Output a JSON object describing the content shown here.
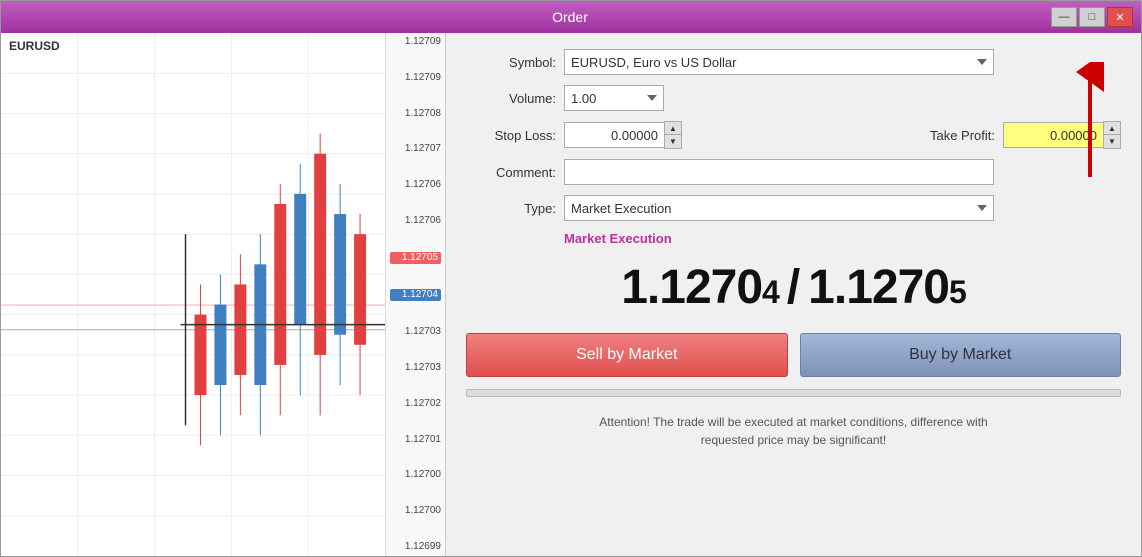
{
  "window": {
    "title": "Order",
    "controls": {
      "minimize": "—",
      "maximize": "□",
      "close": "✕"
    }
  },
  "chart": {
    "symbol_label": "EURUSD",
    "prices": [
      "1.12709",
      "1.12709",
      "1.12708",
      "1.12707",
      "1.12706",
      "1.12706",
      "1.12705",
      "1.12704",
      "1.12703",
      "1.12703",
      "1.12702",
      "1.12701",
      "1.12700",
      "1.12700",
      "1.12699"
    ],
    "highlight_red": "1.12705",
    "highlight_blue": "1.12704"
  },
  "form": {
    "symbol_label": "Symbol:",
    "symbol_value": "EURUSD, Euro vs US Dollar",
    "volume_label": "Volume:",
    "volume_value": "1.00",
    "stop_loss_label": "Stop Loss:",
    "stop_loss_value": "0.00000",
    "take_profit_label": "Take Profit:",
    "take_profit_value": "0.00000",
    "comment_label": "Comment:",
    "comment_value": "",
    "type_label": "Type:",
    "type_value": "Market Execution",
    "market_exec_label": "Market Execution",
    "bid_price": "1.12704",
    "ask_price": "1.12705",
    "bid_main": "1.12704",
    "ask_main": "1.12705",
    "sell_btn": "Sell by Market",
    "buy_btn": "Buy by Market",
    "attention_line1": "Attention! The trade will be executed at market conditions, difference with",
    "attention_line2": "requested price may be significant!"
  }
}
